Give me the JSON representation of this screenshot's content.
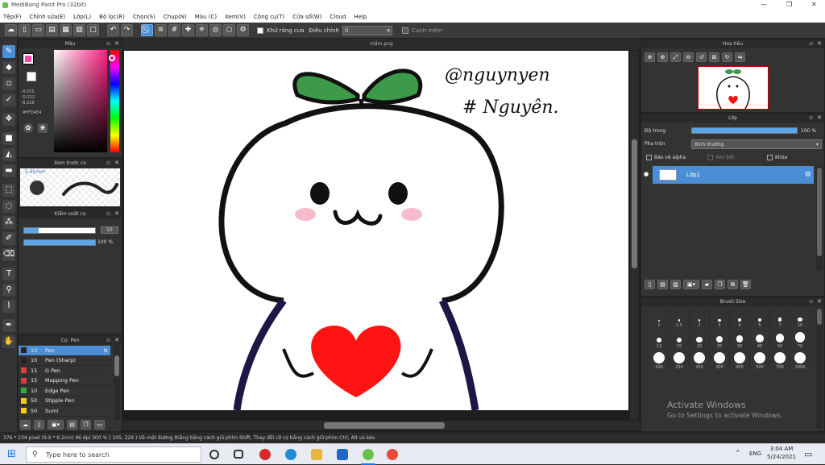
{
  "app": {
    "title": "MediBang Paint Pro (32bit)"
  },
  "menu": [
    "Tệp(F)",
    "Chỉnh sửa(E)",
    "Lớp(L)",
    "Bộ lọc(R)",
    "Chọn(S)",
    "Chụp(N)",
    "Màu (C)",
    "Xem(V)",
    "Công cụ(T)",
    "Cửa sổ(W)",
    "Cloud",
    "Help"
  ],
  "toolbar": {
    "antialias": "Khử răng cưa",
    "adjust": "Điều chỉnh",
    "adjust_value": "0",
    "snap": "Canh mềm"
  },
  "color_panel": {
    "title": "Màu",
    "r": "R:255",
    "g": "G:212",
    "b": "B:228",
    "hex": "#FFD4E4",
    "fg_color": "#fd48a5"
  },
  "preview_panel": {
    "title": "Xem trước cọ",
    "size": "2.65mm"
  },
  "brush_control": {
    "title": "Kiểm soát cọ",
    "size_value": "10",
    "opacity_value": "100 %",
    "size_fraction": 0.2,
    "opacity_fraction": 1.0
  },
  "brush_panel": {
    "title": "Cọ: Pen",
    "items": [
      {
        "size": "10",
        "name": "Pen",
        "color": "#222222",
        "selected": true
      },
      {
        "size": "10",
        "name": "Pen (Sharp)",
        "color": "#222222",
        "selected": false
      },
      {
        "size": "15",
        "name": "G Pen",
        "color": "#e23b3b",
        "selected": false
      },
      {
        "size": "15",
        "name": "Mapping Pen",
        "color": "#e23b3b",
        "selected": false
      },
      {
        "size": "10",
        "name": "Edge Pen",
        "color": "#2fae3a",
        "selected": false
      },
      {
        "size": "50",
        "name": "Stipple Pen",
        "color": "#f0d000",
        "selected": false
      },
      {
        "size": "50",
        "name": "Sumi",
        "color": "#f0d000",
        "selected": false
      }
    ]
  },
  "canvas": {
    "tab": "mầm.png",
    "text1": "@nguynyen",
    "text2": "# Nguyên."
  },
  "navigator": {
    "title": "Hoa tiêu"
  },
  "layers": {
    "title": "Lớp",
    "opacity_label": "Độ trong",
    "opacity_value": "100 %",
    "opacity_fraction": 1.0,
    "blend_label": "Pha trộn",
    "blend_value": "Bình thường",
    "protect_alpha": "Bảo vệ alpha",
    "clipping": "Xén bớt",
    "lock": "Khóa",
    "layer1": "Lớp1"
  },
  "brush_size": {
    "title": "Brush Size",
    "sizes": [
      "1",
      "1.5",
      "2",
      "3",
      "4",
      "5",
      "7",
      "10",
      "13",
      "15",
      "20",
      "25",
      "30",
      "40",
      "50",
      "70",
      "100",
      "150",
      "200",
      "300",
      "400",
      "500",
      "700",
      "1000"
    ]
  },
  "status": "376 * 234 pixel   (9.9 * 6.2cm)   96 dpi   300 %   ( 105, 229 )   Vẽ một đường thẳng bằng cách giữ phím Shift, Thay đổi cỡ cọ bằng cách giữ phím Ctrl, Alt và kéo",
  "watermark": {
    "line1": "Activate Windows",
    "line2": "Go to Settings to activate Windows."
  },
  "taskbar": {
    "search": "Type here to search",
    "lang": "ENG",
    "time": "3:04 AM",
    "date": "5/24/2021"
  }
}
